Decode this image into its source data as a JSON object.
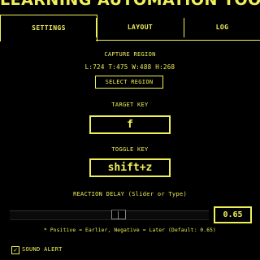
{
  "app": {
    "title": "LEARNING AUTOMATION TOOL"
  },
  "tabs": [
    {
      "label": "SETTINGS",
      "active": true
    },
    {
      "label": "LAYOUT",
      "active": false
    },
    {
      "label": "LOG",
      "active": false
    }
  ],
  "capture": {
    "heading": "CAPTURE REGION",
    "coords": "L:724 T:475 W:488 H:268",
    "button_label": "SELECT REGION"
  },
  "target_key": {
    "label": "TARGET KEY",
    "value": "f"
  },
  "toggle_key": {
    "label": "TOGGLE KEY",
    "value": "shift+z"
  },
  "reaction_delay": {
    "label": "REACTION DELAY (Slider or Type)",
    "value": "0.65",
    "slider_position": 0.55,
    "note": "* Positive = Earlier, Negative = Later (Default: 0.65)"
  },
  "sound_alert": {
    "label": "SOUND ALERT",
    "checked": true,
    "check_glyph": "✓"
  },
  "colors": {
    "accent": "#f0f05a",
    "background": "#000000"
  }
}
